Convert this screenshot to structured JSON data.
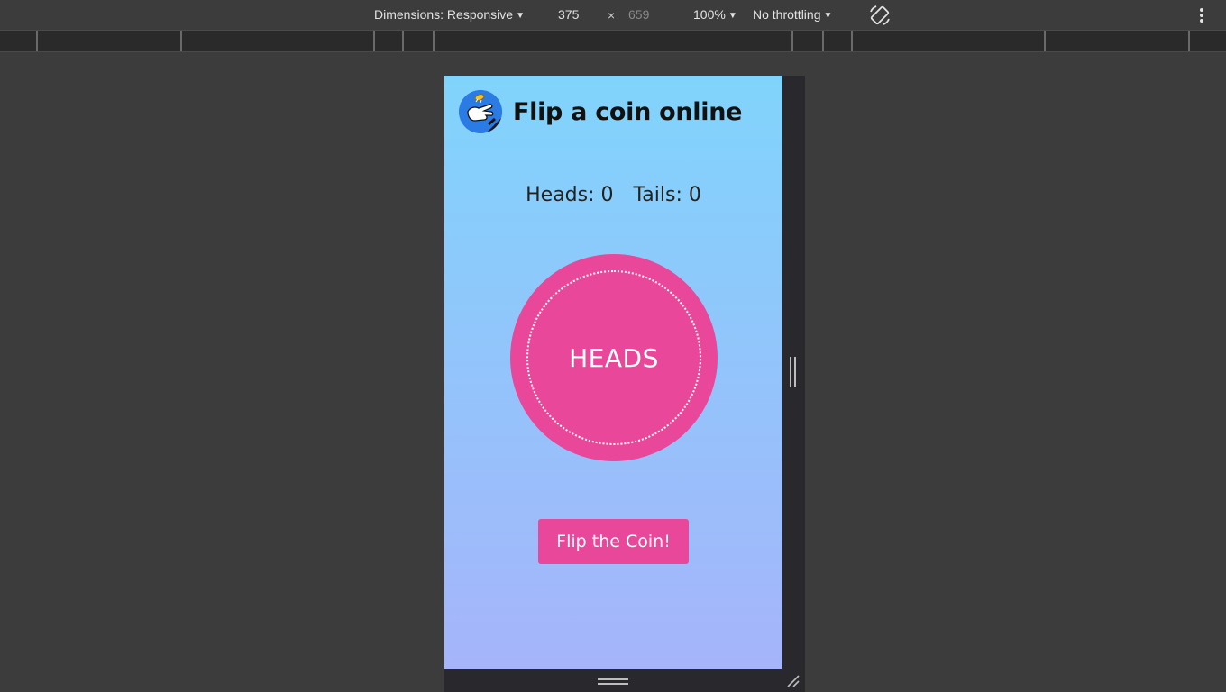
{
  "devtools": {
    "dimensions_label": "Dimensions: Responsive",
    "width_value": "375",
    "times_symbol": "×",
    "height_value": "659",
    "zoom_label": "100%",
    "throttling_label": "No throttling",
    "caret": "▼",
    "icons": [
      "rotate-icon",
      "more-vertical-icon",
      "resize-handle-icon"
    ]
  },
  "app": {
    "title": "Flip a coin online",
    "logo_icon": "hand-flipping-coin-icon",
    "scoreboard": {
      "heads_label": "Heads: 0",
      "tails_label": "Tails: 0"
    },
    "coin": {
      "face_label": "HEADS"
    },
    "flip_button_label": "Flip the Coin!",
    "colors": {
      "accent": "#e9489a",
      "gradient_top": "#80d4fc",
      "gradient_bottom": "#a6b4fa"
    }
  }
}
